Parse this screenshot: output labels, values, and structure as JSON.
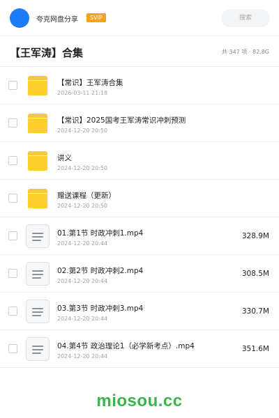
{
  "topbar": {
    "brand": "夸克网盘分享",
    "badge": "SVIP",
    "search_placeholder": "搜索"
  },
  "header": {
    "title": "【王军涛】合集",
    "summary": "共 347 项 · 82.8G"
  },
  "items": [
    {
      "type": "folder",
      "name": "【常识】王军涛合集",
      "date": "2026-03-11 21:18",
      "size": ""
    },
    {
      "type": "folder",
      "name": "【常识】2025国考王军涛常识冲刺预测",
      "date": "2024-12-20 20:50",
      "size": ""
    },
    {
      "type": "folder",
      "name": "讲义",
      "date": "2024-12-20 20:50",
      "size": ""
    },
    {
      "type": "folder",
      "name": "赠送课程（更新）",
      "date": "2024-12-20 20:50",
      "size": ""
    },
    {
      "type": "file",
      "name": "01.第1节 时政冲刺1.mp4",
      "date": "2024-12-20 20:44",
      "size": "328.9M"
    },
    {
      "type": "file",
      "name": "02.第2节 时政冲刺2.mp4",
      "date": "2024-12-20 20:44",
      "size": "308.5M"
    },
    {
      "type": "file",
      "name": "03.第3节 时政冲刺3.mp4",
      "date": "2024-12-20 20:44",
      "size": "330.7M"
    },
    {
      "type": "file",
      "name": "04.第4节 政治理论1（必学新考点）.mp4",
      "date": "2024-12-20 20:44",
      "size": "351.6M"
    }
  ],
  "watermark": "miosou.cc",
  "colors": {
    "accent": "#1e7cf8",
    "badge": "#f7a21b",
    "folder": "#ffcf2d",
    "watermark": "#3ab54a"
  },
  "icons": {
    "folder": "folder-icon",
    "file": "document-icon"
  }
}
